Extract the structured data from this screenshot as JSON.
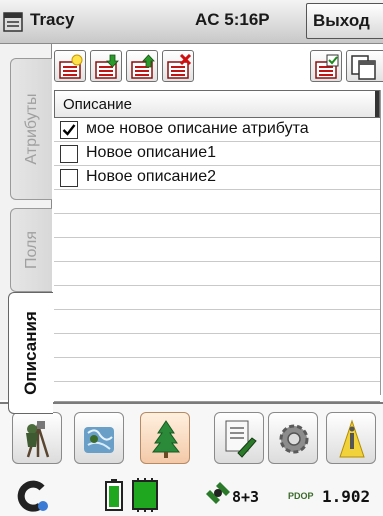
{
  "titlebar": {
    "title": "Tracy",
    "status": "AC  5:16P",
    "exit_label": "Выход"
  },
  "tabs": [
    {
      "label": "Атрибуты",
      "active": false
    },
    {
      "label": "Поля",
      "active": false
    },
    {
      "label": "Описания",
      "active": true
    }
  ],
  "toolbar": {
    "buttons": [
      "new-item-icon",
      "import-icon",
      "export-icon",
      "delete-item-icon",
      "check-all-icon",
      "copy-icon"
    ]
  },
  "grid": {
    "header": "Описание",
    "rows": [
      {
        "label": "мое новое описание атрибута",
        "checked": true
      },
      {
        "label": "Новое описание1",
        "checked": false
      },
      {
        "label": "Новое описание2",
        "checked": false
      }
    ]
  },
  "bottombar": {
    "buttons": [
      "survey-icon",
      "map-icon",
      "tree-icon",
      "notes-icon",
      "settings-icon",
      "info-icon"
    ]
  },
  "statusbar": {
    "satellites": "8+3",
    "pdop_label": "PDOP",
    "pdop_value": "1.902"
  },
  "colors": {
    "accent": "#2a7a2a",
    "battery": "#1fa81f",
    "delete_red": "#cc1111"
  }
}
